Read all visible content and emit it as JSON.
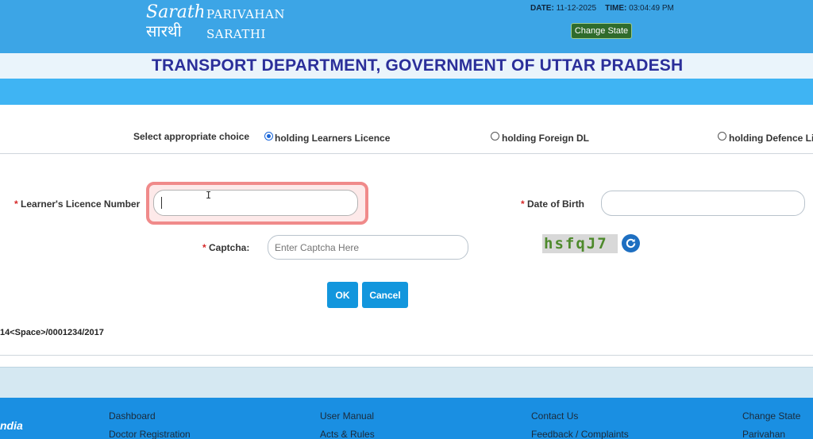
{
  "header": {
    "logo_script": "Sarathi",
    "logo_line1": "PARIVAHAN",
    "logo_line2": "SARATHI",
    "date_label": "DATE:",
    "date_value": "11-12-2025",
    "time_label": "TIME:",
    "time_value": "03:04:49 PM",
    "change_state": "Change State"
  },
  "department_title": "TRANSPORT DEPARTMENT, GOVERNMENT OF UTTAR PRADESH",
  "choice": {
    "label": "Select appropriate choice",
    "options": [
      {
        "label": "holding Learners Licence",
        "selected": true
      },
      {
        "label": "holding Foreign DL",
        "selected": false
      },
      {
        "label": "holding Defence Lic",
        "selected": false
      }
    ]
  },
  "form": {
    "ll_label": "Learner's Licence Number",
    "ll_value": "",
    "dob_label": "Date of Birth",
    "dob_value": "",
    "captcha_label": "Captcha:",
    "captcha_placeholder": "Enter Captcha Here",
    "captcha_text": "hsfqJ7",
    "required_mark": "* ",
    "ok_label": "OK",
    "cancel_label": "Cancel",
    "example_text": "14<Space>/0001234/2017"
  },
  "footer": {
    "logo_text": "ndia",
    "links": [
      "Dashboard",
      "Doctor Registration",
      "User Manual",
      "Acts & Rules",
      "Contact Us",
      "Feedback / Complaints",
      "Change State",
      "Parivahan"
    ]
  },
  "colors": {
    "header_bg": "#3ca5e6",
    "accent_blue": "#1296dd",
    "title_navy": "#2b2f9a",
    "highlight": "#f08a8a"
  }
}
